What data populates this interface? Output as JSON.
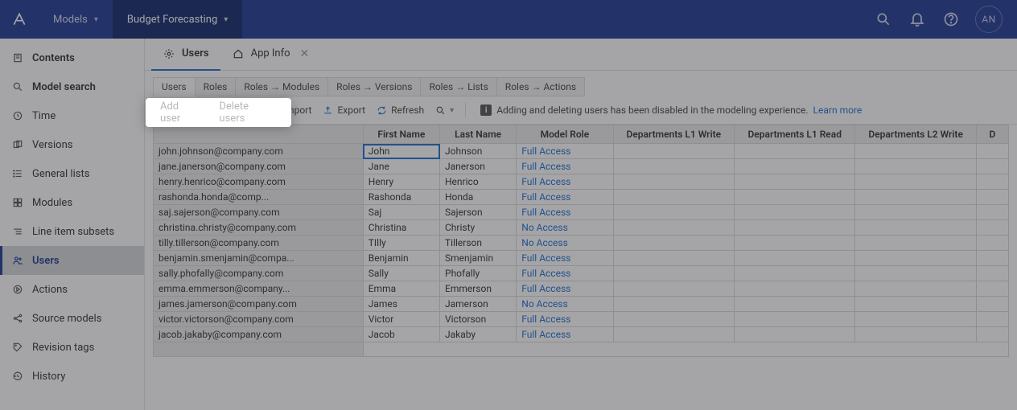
{
  "topnav": {
    "tabs": [
      {
        "label": "Models"
      },
      {
        "label": "Budget Forecasting"
      }
    ],
    "avatar": "AN"
  },
  "sidebar": {
    "items": [
      {
        "label": "Contents"
      },
      {
        "label": "Model search"
      },
      {
        "label": "Time"
      },
      {
        "label": "Versions"
      },
      {
        "label": "General lists"
      },
      {
        "label": "Modules"
      },
      {
        "label": "Line item subsets"
      },
      {
        "label": "Users"
      },
      {
        "label": "Actions"
      },
      {
        "label": "Source models"
      },
      {
        "label": "Revision tags"
      },
      {
        "label": "History"
      }
    ]
  },
  "crumbs": {
    "users": "Users",
    "appinfo": "App Info"
  },
  "subtabs": {
    "items": [
      "Users",
      "Roles",
      "Roles → Modules",
      "Roles → Versions",
      "Roles → Lists",
      "Roles → Actions"
    ]
  },
  "toolbar": {
    "add_user": "Add user",
    "delete_users": "Delete users",
    "import": "Import",
    "export": "Export",
    "refresh": "Refresh",
    "info_text": "Adding and deleting users has been disabled in the modeling experience.",
    "learn_more": "Learn more"
  },
  "table": {
    "headers": {
      "email": "",
      "first": "First Name",
      "last": "Last Name",
      "role": "Model Role",
      "d1w": "Departments L1 Write",
      "d1r": "Departments L1 Read",
      "d2w": "Departments L2 Write",
      "d_more": "D"
    },
    "rows": [
      {
        "email": "john.johnson@company.com",
        "first": "John",
        "last": "Johnson",
        "role": "Full Access"
      },
      {
        "email": "jane.janerson@company.com",
        "first": "Jane",
        "last": "Janerson",
        "role": "Full Access"
      },
      {
        "email": "henry.henrico@company.com",
        "first": "Henry",
        "last": "Henrico",
        "role": "Full Access"
      },
      {
        "email": "rashonda.honda@comp...",
        "first": "Rashonda",
        "last": "Honda",
        "role": "Full Access"
      },
      {
        "email": "saj.sajerson@company.com",
        "first": "Saj",
        "last": "Sajerson",
        "role": "Full Access"
      },
      {
        "email": "christina.christy@company.com",
        "first": "Christina",
        "last": "Christy",
        "role": "No Access"
      },
      {
        "email": "tilly.tillerson@company.com",
        "first": "TIlly",
        "last": "Tillerson",
        "role": "No Access"
      },
      {
        "email": "benjamin.smenjamin@compa...",
        "first": "Benjamin",
        "last": "Smenjamin",
        "role": "Full Access"
      },
      {
        "email": "sally.phofally@company.com",
        "first": "Sally",
        "last": "Phofally",
        "role": "Full Access"
      },
      {
        "email": "emma.emmerson@company...",
        "first": "Emma",
        "last": "Emmerson",
        "role": "Full Access"
      },
      {
        "email": "james.jamerson@company.com",
        "first": "James",
        "last": "Jamerson",
        "role": "No Access"
      },
      {
        "email": "victor.victorson@company.com",
        "first": "Victor",
        "last": "Victorson",
        "role": "Full Access"
      },
      {
        "email": "jacob.jakaby@company.com",
        "first": "Jacob",
        "last": "Jakaby",
        "role": "Full Access"
      }
    ]
  },
  "callout": {
    "add_user": "Add user",
    "delete_users": "Delete users"
  }
}
